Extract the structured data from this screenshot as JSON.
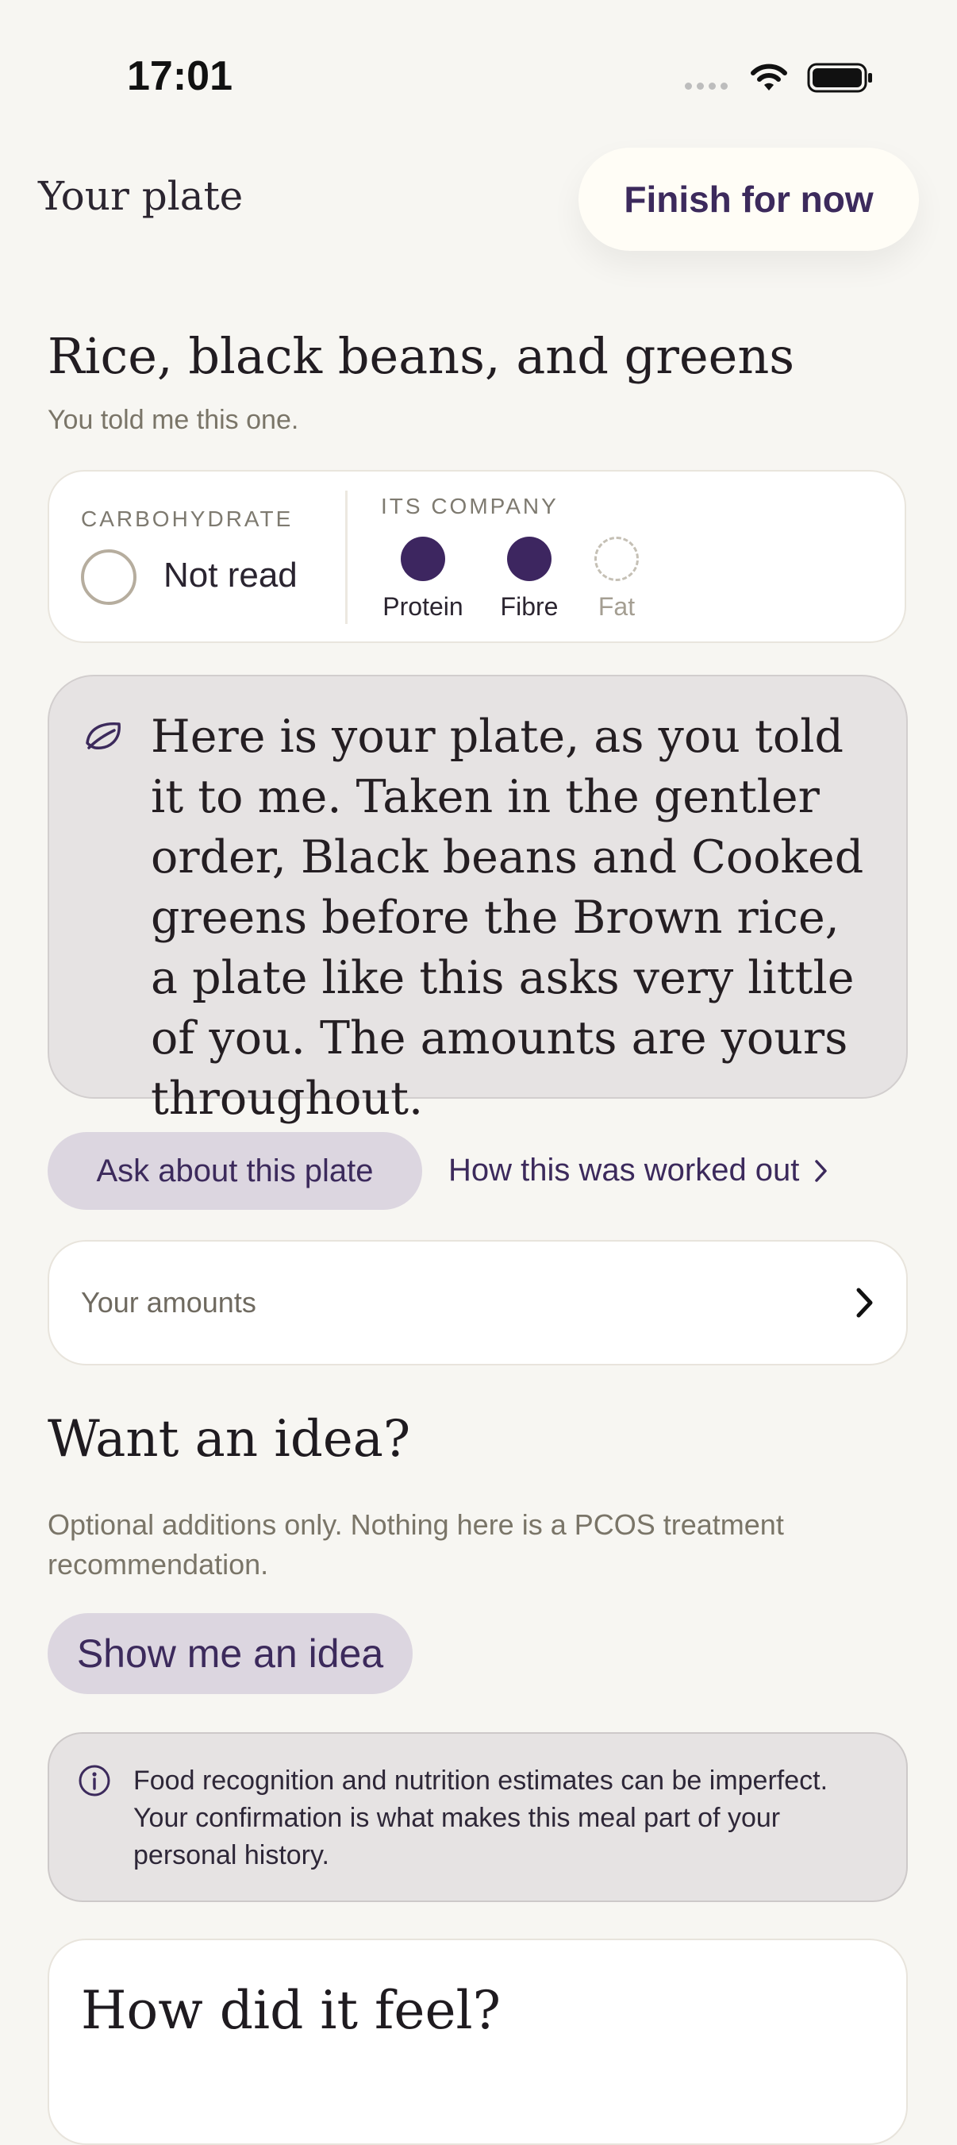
{
  "status_bar": {
    "time": "17:01"
  },
  "header": {
    "title": "Your plate",
    "finish_label": "Finish for now"
  },
  "meal": {
    "title": "Rice, black beans, and greens",
    "subtitle": "You told me this one."
  },
  "macros": {
    "carb_label": "CARBOHYDRATE",
    "carb_value": "Not read",
    "company_label": "ITS COMPANY",
    "company": [
      {
        "label": "Protein",
        "filled": true
      },
      {
        "label": "Fibre",
        "filled": true
      },
      {
        "label": "Fat",
        "filled": false
      }
    ]
  },
  "message": {
    "text": "Here is your plate, as you told it to me. Taken in the gentler order, Black beans and Cooked greens before the Brown rice, a plate like this asks very little of you. The amounts are yours throughout."
  },
  "actions": {
    "ask_label": "Ask about this plate",
    "how_label": "How this was worked out"
  },
  "amounts": {
    "label": "Your amounts"
  },
  "idea": {
    "title": "Want an idea?",
    "subtitle": "Optional additions only. Nothing here is a PCOS treatment recommendation.",
    "button_label": "Show me an idea"
  },
  "notice": {
    "text": "Food recognition and nutrition estimates can be imperfect. Your confirmation is what makes this meal part of your personal history."
  },
  "feel": {
    "title": "How did it feel?"
  },
  "colors": {
    "accent": "#3c2a5c",
    "background": "#f7f6f2",
    "pill": "#dcd6e0"
  }
}
